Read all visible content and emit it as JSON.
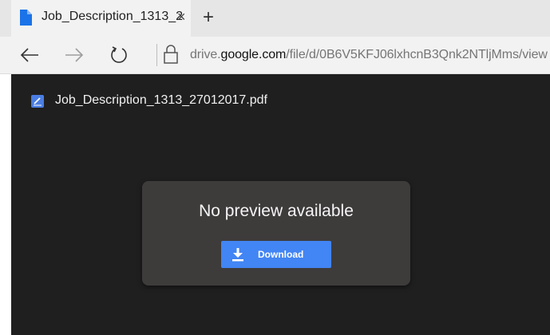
{
  "browser": {
    "tab": {
      "title": "Job_Description_1313_2",
      "close_glyph": "×",
      "icon": "document-icon",
      "icon_color": "#1a73e8"
    },
    "new_tab_glyph": "+",
    "nav": {
      "back_icon": "back-arrow-icon",
      "forward_icon": "forward-arrow-icon",
      "refresh_icon": "refresh-icon",
      "lock_icon": "lock-icon"
    },
    "url": {
      "prefix": "drive.",
      "host": "google.com",
      "path": "/file/d/0B6V5KFJ06lxhcnB3Qnk2NTljMms/view"
    }
  },
  "viewer": {
    "file_name": "Job_Description_1313_27012017.pdf",
    "file_icon": "pdf-file-icon",
    "message": "No preview available",
    "download_label": "Download",
    "download_icon": "download-icon",
    "colors": {
      "background": "#1f1f1f",
      "card": "#3e3b3b",
      "button": "#4285f4"
    }
  }
}
